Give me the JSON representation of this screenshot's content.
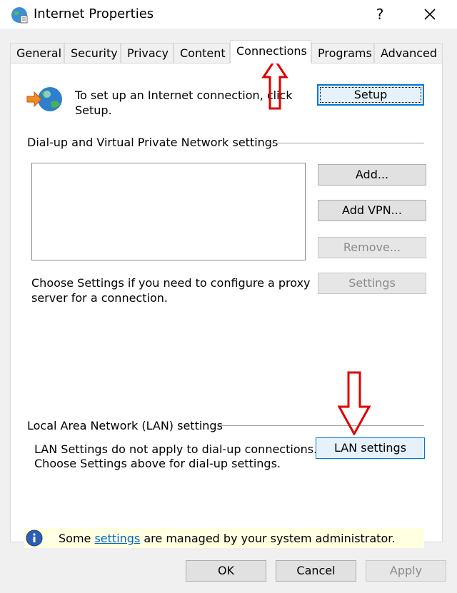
{
  "window": {
    "title": "Internet Properties",
    "help_label": "?"
  },
  "tabs": [
    {
      "label": "General"
    },
    {
      "label": "Security"
    },
    {
      "label": "Privacy"
    },
    {
      "label": "Content"
    },
    {
      "label": "Connections",
      "active": true
    },
    {
      "label": "Programs"
    },
    {
      "label": "Advanced"
    }
  ],
  "setup": {
    "line1": "To set up an Internet connection, click",
    "line2": "Setup.",
    "button": "Setup"
  },
  "dialup": {
    "heading": "Dial-up and Virtual Private Network settings",
    "add_button": "Add...",
    "add_vpn_button": "Add VPN...",
    "remove_button": "Remove...",
    "settings_button": "Settings",
    "help_line1": "Choose Settings if you need to configure a proxy",
    "help_line2": "server for a connection."
  },
  "lan": {
    "heading": "Local Area Network (LAN) settings",
    "line1": "LAN Settings do not apply to dial-up connections.",
    "line2": "Choose Settings above for dial-up settings.",
    "button": "LAN settings"
  },
  "info": {
    "prefix": "Some ",
    "link": "settings",
    "suffix": " are managed by your system administrator."
  },
  "footer": {
    "ok": "OK",
    "cancel": "Cancel",
    "apply": "Apply"
  },
  "icons": [
    "internet-globe-icon",
    "connection-wizard-icon",
    "info-icon",
    "close-icon",
    "red-arrow-up-icon",
    "red-arrow-down-icon"
  ],
  "colors": {
    "focus_blue": "#0078d7",
    "info_bg": "#ffffe1",
    "arrow_red": "#e00000",
    "link": "#0066cc"
  }
}
